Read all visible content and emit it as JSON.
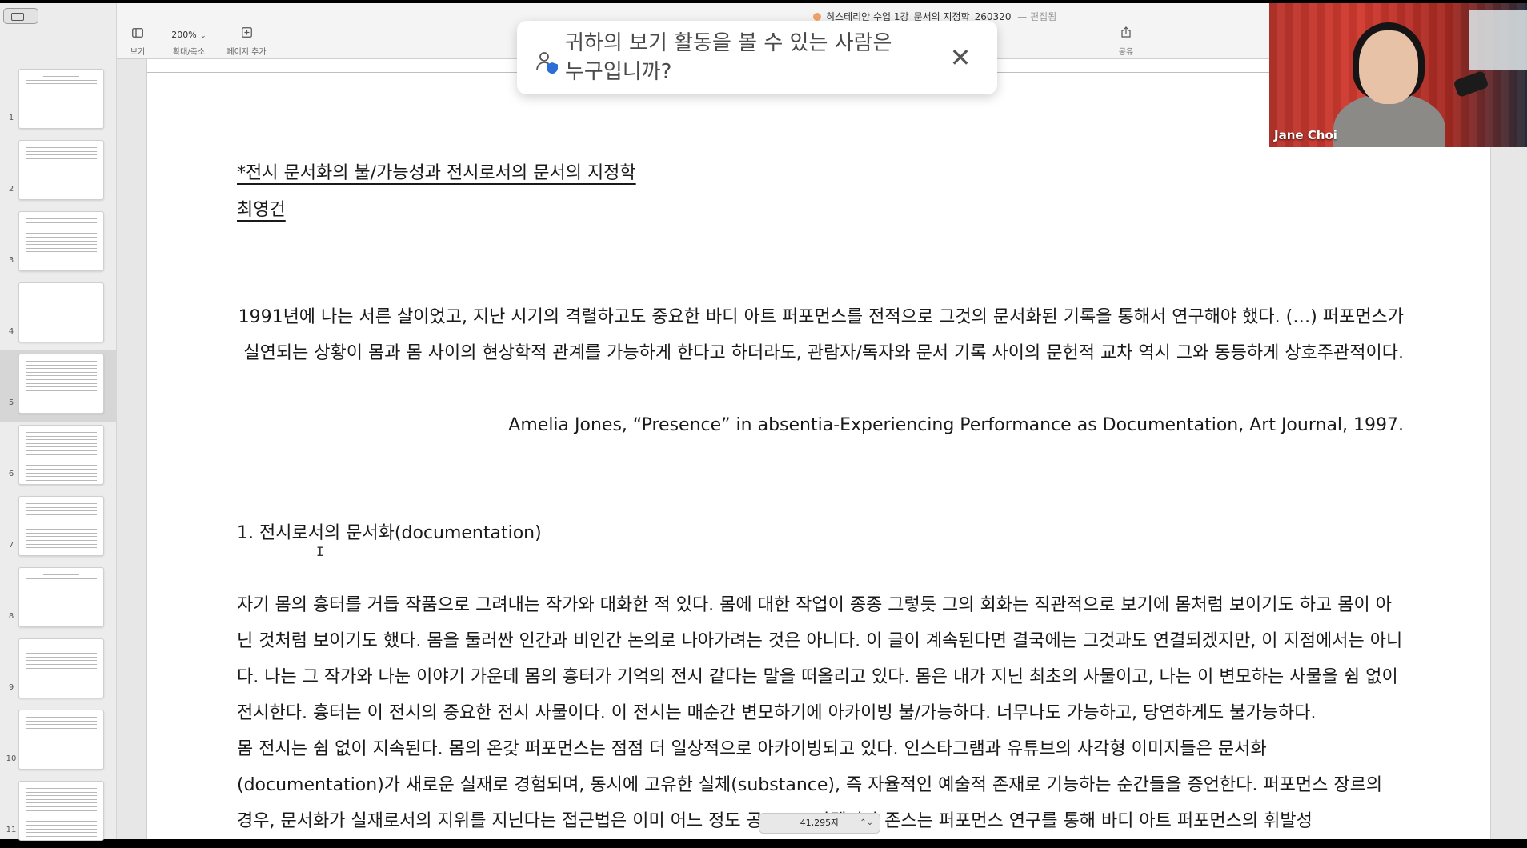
{
  "window": {
    "title": "히스테리안 수업 1강_문서의 지정학_260320",
    "status": "편집됨"
  },
  "toolbar": {
    "view_label": "보기",
    "zoom_value": "200%",
    "zoom_label": "확대/축소",
    "add_page_label": "페이지 추가",
    "share_label": "공유"
  },
  "sidebar": {
    "pages": [
      {
        "num": "1"
      },
      {
        "num": "2"
      },
      {
        "num": "3"
      },
      {
        "num": "4"
      },
      {
        "num": "5"
      },
      {
        "num": "6"
      },
      {
        "num": "7"
      },
      {
        "num": "8"
      },
      {
        "num": "9"
      },
      {
        "num": "10"
      },
      {
        "num": "11"
      }
    ],
    "selected_page": "5"
  },
  "popup": {
    "text": "귀하의 보기 활동을 볼 수 있는 사람은 누구입니까?"
  },
  "video": {
    "participant_name": "Jane Choi"
  },
  "document": {
    "title": "*전시 문서화의 불/가능성과 전시로서의 문서의 지정학",
    "author": "최영건",
    "quote": "1991년에 나는 서른 살이었고, 지난 시기의 격렬하고도 중요한 바디 아트 퍼포먼스를 전적으로 그것의 문서화된 기록을 통해서 연구해야 했다. (…) 퍼포먼스가 실연되는 상황이 몸과 몸 사이의 현상학적 관계를 가능하게 한다고 하더라도, 관람자/독자와 문서 기록 사이의 문헌적 교차 역시 그와 동등하게 상호주관적이다.",
    "citation": "Amelia Jones, “Presence” in absentia-Experiencing Performance as Documentation, Art Journal, 1997.",
    "section_heading": "1. 전시로서의 문서화(documentation)",
    "body": "자기 몸의 흉터를 거듭 작품으로 그려내는 작가와 대화한 적 있다. 몸에 대한 작업이 종종 그렇듯 그의 회화는 직관적으로 보기에 몸처럼 보이기도 하고 몸이 아닌 것처럼 보이기도 했다. 몸을 둘러싼 인간과 비인간 논의로 나아가려는 것은 아니다. 이 글이 계속된다면 결국에는 그것과도 연결되겠지만, 이 지점에서는 아니다. 나는 그 작가와 나눈 이야기 가운데 몸의 흉터가 기억의 전시 같다는 말을 떠올리고 있다. 몸은 내가 지닌 최초의 사물이고, 나는 이 변모하는 사물을 쉼 없이 전시한다. 흉터는 이 전시의 중요한 전시 사물이다. 이 전시는 매순간 변모하기에 아카이빙 불/가능하다. 너무나도 가능하고, 당연하게도 불가능하다.",
    "body2": "몸 전시는 쉼 없이 지속된다. 몸의 온갖 퍼포먼스는 점점 더 일상적으로 아카이빙되고 있다. 인스타그램과 유튜브의 사각형 이미지들은 문서화(documentation)가 새로운 실재로 경험되며, 동시에 고유한 실체(substance), 즉 자율적인 예술적 존재로 기능하는 순간들을 증언한다. 퍼포먼스 장르의 경우, 문서화가 실재로서의 지위를 지닌다는 접근법은 이미 어느 정도 공고",
    "body2_tail": "아멜리아 존스는 퍼포먼스 연구를 통해 바디 아트 퍼포먼스의 휘발성"
  },
  "status_bar": {
    "word_count": "41,295자"
  },
  "icons": {
    "sidebar_toggle": "sidebar-icon",
    "view": "sidebar-panel-icon",
    "add_page": "plus-box-icon",
    "share": "share-icon",
    "privacy": "person-shield-icon",
    "close": "close-icon"
  },
  "colors": {
    "privacy_accent": "#2b6fd6",
    "title_dot": "#f0a46a"
  }
}
